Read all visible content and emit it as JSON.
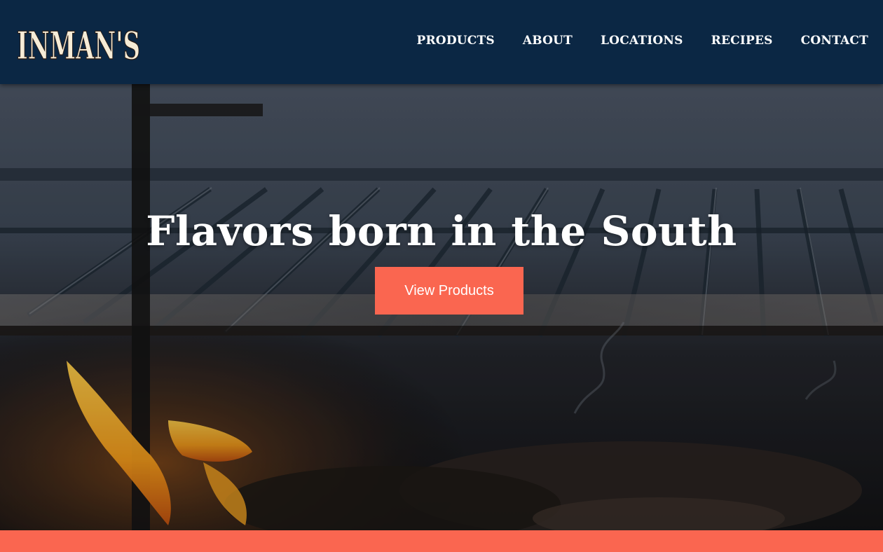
{
  "brand": {
    "logo_text": "INMAN'S"
  },
  "nav": {
    "items": [
      {
        "label": "PRODUCTS"
      },
      {
        "label": "ABOUT"
      },
      {
        "label": "LOCATIONS"
      },
      {
        "label": "RECIPES"
      },
      {
        "label": "CONTACT"
      }
    ]
  },
  "hero": {
    "title": "Flavors born in the South",
    "button_label": "View Products"
  },
  "colors": {
    "header_bg": "#0b2744",
    "accent": "#fa6650",
    "logo_cream": "#f6ecd7"
  }
}
